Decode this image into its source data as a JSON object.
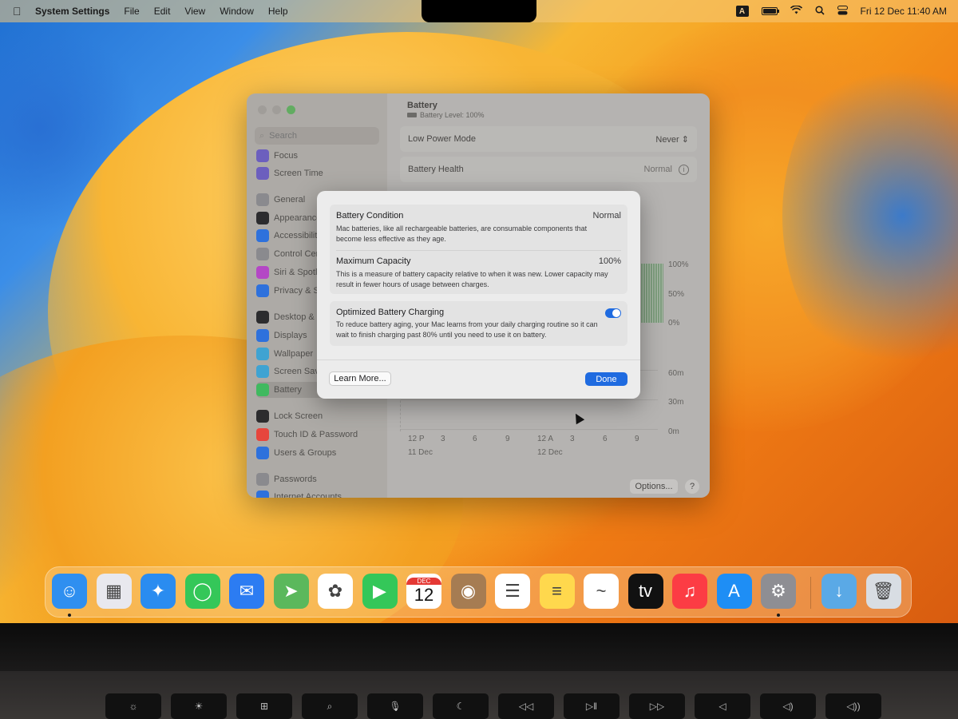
{
  "menubar": {
    "app_name": "System Settings",
    "menus": [
      "File",
      "Edit",
      "View",
      "Window",
      "Help"
    ],
    "input_badge": "A",
    "datetime": "Fri 12 Dec  11:40 AM"
  },
  "sidebar": {
    "search_placeholder": "Search",
    "items": [
      {
        "label": "Focus",
        "icon": "moon-icon",
        "color": "#6a5acd"
      },
      {
        "label": "Screen Time",
        "icon": "hourglass-icon",
        "color": "#6a5acd"
      },
      {
        "label": "General",
        "icon": "gear-icon",
        "color": "#8e8e93"
      },
      {
        "label": "Appearance",
        "icon": "appearance-icon",
        "color": "#1c1c1e"
      },
      {
        "label": "Accessibility",
        "icon": "accessibility-icon",
        "color": "#1e6ff2"
      },
      {
        "label": "Control Centre",
        "icon": "control-centre-icon",
        "color": "#8e8e93"
      },
      {
        "label": "Siri & Spotlight",
        "icon": "siri-icon",
        "color": "#c13cd6"
      },
      {
        "label": "Privacy & Security",
        "icon": "hand-icon",
        "color": "#1e6ff2"
      },
      {
        "label": "Desktop & Dock",
        "icon": "desktop-icon",
        "color": "#1c1c1e"
      },
      {
        "label": "Displays",
        "icon": "displays-icon",
        "color": "#1e6ff2"
      },
      {
        "label": "Wallpaper",
        "icon": "wallpaper-icon",
        "color": "#32ade6"
      },
      {
        "label": "Screen Saver",
        "icon": "screen-saver-icon",
        "color": "#32ade6"
      },
      {
        "label": "Battery",
        "icon": "battery-icon",
        "color": "#34c759"
      },
      {
        "label": "Lock Screen",
        "icon": "lock-icon",
        "color": "#1c1c1e"
      },
      {
        "label": "Touch ID & Password",
        "icon": "fingerprint-icon",
        "color": "#ff3b30"
      },
      {
        "label": "Users & Groups",
        "icon": "users-icon",
        "color": "#1e6ff2"
      },
      {
        "label": "Passwords",
        "icon": "key-icon",
        "color": "#8e8e93"
      },
      {
        "label": "Internet Accounts",
        "icon": "at-icon",
        "color": "#1e6ff2"
      }
    ]
  },
  "content": {
    "title": "Battery",
    "level_text": "Battery Level: 100%",
    "low_power": {
      "label": "Low Power Mode",
      "value": "Never"
    },
    "health": {
      "label": "Battery Health",
      "value": "Normal"
    },
    "chart_axis": {
      "pct": [
        "100%",
        "50%",
        "0%"
      ],
      "mins": [
        "60m",
        "30m",
        "0m"
      ],
      "times": [
        "12 P",
        "3",
        "6",
        "9",
        "12 A",
        "3",
        "6",
        "9"
      ],
      "days": [
        "11 Dec",
        "12 Dec"
      ]
    },
    "options_label": "Options...",
    "help_label": "?"
  },
  "sheet": {
    "condition": {
      "title": "Battery Condition",
      "value": "Normal",
      "desc": "Mac batteries, like all rechargeable batteries, are consumable components that become less effective as they age."
    },
    "capacity": {
      "title": "Maximum Capacity",
      "value": "100%",
      "desc": "This is a measure of battery capacity relative to when it was new. Lower capacity may result in fewer hours of usage between charges."
    },
    "optimized": {
      "title": "Optimized Battery Charging",
      "desc": "To reduce battery aging, your Mac learns from your daily charging routine so it can wait to finish charging past 80% until you need to use it on battery.",
      "enabled": true
    },
    "learn_more": "Learn More...",
    "done": "Done"
  },
  "dock": {
    "apps": [
      {
        "name": "Finder",
        "icon": "finder-icon",
        "color": "#2f8ff0",
        "glyph": "☺"
      },
      {
        "name": "Launchpad",
        "icon": "launchpad-icon",
        "color": "#e8e8ee",
        "glyph": "▦"
      },
      {
        "name": "Safari",
        "icon": "safari-icon",
        "color": "#2a8cf0",
        "glyph": "✦"
      },
      {
        "name": "Messages",
        "icon": "messages-icon",
        "color": "#34c759",
        "glyph": "◯"
      },
      {
        "name": "Mail",
        "icon": "mail-icon",
        "color": "#2c7cf2",
        "glyph": "✉"
      },
      {
        "name": "Maps",
        "icon": "maps-icon",
        "color": "#5bb85c",
        "glyph": "➤"
      },
      {
        "name": "Photos",
        "icon": "photos-icon",
        "color": "#ffffff",
        "glyph": "✿"
      },
      {
        "name": "FaceTime",
        "icon": "facetime-icon",
        "color": "#34c759",
        "glyph": "▶"
      },
      {
        "name": "Calendar",
        "icon": "calendar-icon",
        "color": "#ffffff",
        "month": "DEC",
        "day": "12"
      },
      {
        "name": "Contacts",
        "icon": "contacts-icon",
        "color": "#a67c52",
        "glyph": "◉"
      },
      {
        "name": "Reminders",
        "icon": "reminders-icon",
        "color": "#ffffff",
        "glyph": "☰"
      },
      {
        "name": "Notes",
        "icon": "notes-icon",
        "color": "#ffd84d",
        "glyph": "≡"
      },
      {
        "name": "Freeform",
        "icon": "freeform-icon",
        "color": "#ffffff",
        "glyph": "~"
      },
      {
        "name": "TV",
        "icon": "tv-icon",
        "color": "#111111",
        "glyph": "tv"
      },
      {
        "name": "Music",
        "icon": "music-icon",
        "color": "#fc3c44",
        "glyph": "♫"
      },
      {
        "name": "App Store",
        "icon": "app-store-icon",
        "color": "#1e8ef5",
        "glyph": "A"
      },
      {
        "name": "System Settings",
        "icon": "system-settings-icon",
        "color": "#8e8e93",
        "glyph": "⚙"
      },
      {
        "name": "Downloads",
        "icon": "downloads-folder-icon",
        "color": "#5aa9e6",
        "glyph": "↓"
      },
      {
        "name": "Trash",
        "icon": "trash-icon",
        "color": "#d8dde3",
        "glyph": "🗑"
      }
    ]
  },
  "keyboard": {
    "keys": [
      "☼",
      "☀",
      "⊞",
      "⌕",
      "🎙",
      "☾",
      "◁◁",
      "▷‖",
      "▷▷",
      "◁",
      "◁)",
      "◁))"
    ]
  }
}
